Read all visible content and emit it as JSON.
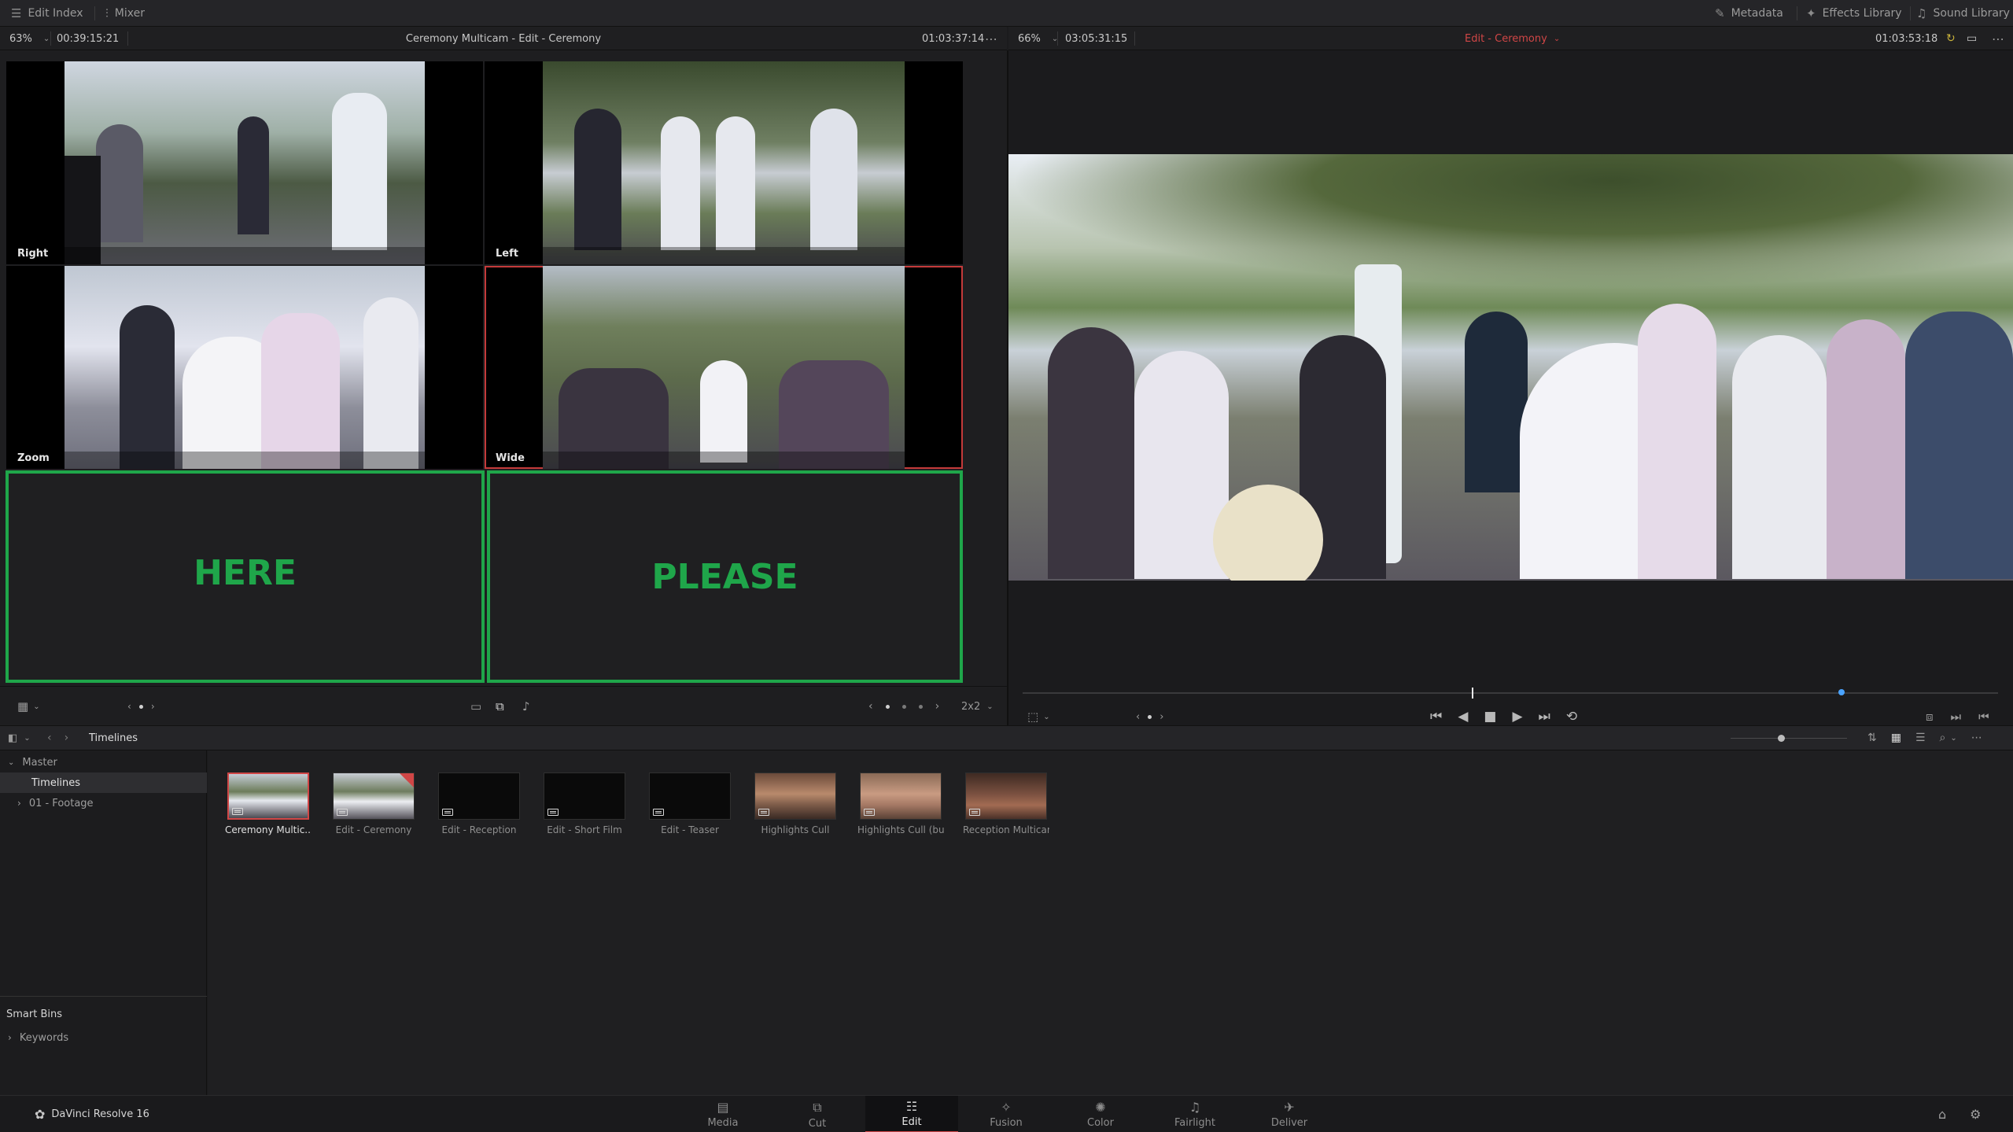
{
  "toolbar": {
    "edit_index": "Edit Index",
    "mixer": "Mixer",
    "metadata": "Metadata",
    "effects_library": "Effects Library",
    "sound_library": "Sound Library"
  },
  "source_viewer": {
    "zoom": "63%",
    "timecode_left": "00:39:15:21",
    "title": "Ceremony Multicam - Edit - Ceremony",
    "timecode_right": "01:03:37:14"
  },
  "timeline_viewer": {
    "zoom": "66%",
    "timecode_left": "03:05:31:15",
    "title": "Edit - Ceremony",
    "timecode_right": "01:03:53:18"
  },
  "multicam": {
    "angles": [
      "Right",
      "Left",
      "Zoom",
      "Wide"
    ],
    "overlay_left": "HERE",
    "overlay_right": "PLEASE",
    "layout": "2x2"
  },
  "media_pool": {
    "breadcrumb": "Timelines",
    "sidebar": {
      "master": "Master",
      "timelines": "Timelines",
      "footage": "01 - Footage",
      "smart_bins": "Smart Bins",
      "keywords": "Keywords"
    },
    "clips": [
      "Ceremony Multic...",
      "Edit - Ceremony",
      "Edit - Reception",
      "Edit - Short Film",
      "Edit - Teaser",
      "Highlights Cull",
      "Highlights Cull (bu)",
      "Reception Multicam"
    ]
  },
  "app": {
    "name": "DaVinci Resolve 16"
  },
  "pages": [
    "Media",
    "Cut",
    "Edit",
    "Fusion",
    "Color",
    "Fairlight",
    "Deliver"
  ],
  "colors": {
    "accent_red": "#d04646",
    "overlay_green": "#1fa64a",
    "playhead_marker": "#4aa3ff"
  }
}
